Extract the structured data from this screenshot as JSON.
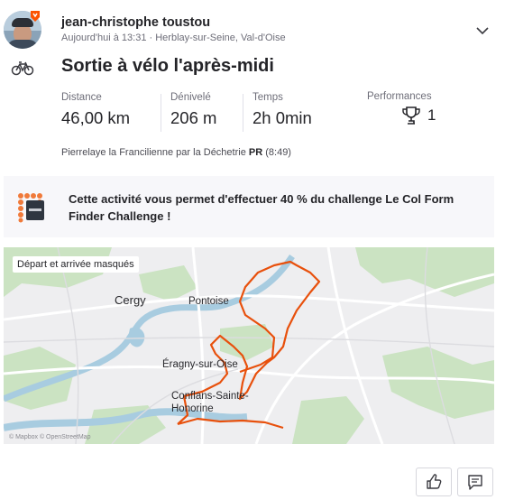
{
  "header": {
    "athlete_name": "jean-christophe toustou",
    "meta": "Aujourd'hui à 13:31 · Herblay-sur-Seine, Val-d'Oise"
  },
  "activity": {
    "title": "Sortie à vélo l'après-midi",
    "type_icon": "bike-icon"
  },
  "stats": [
    {
      "label": "Distance",
      "value": "46,00 km"
    },
    {
      "label": "Dénivelé",
      "value": "206 m"
    },
    {
      "label": "Temps",
      "value": "2h 0min"
    }
  ],
  "performances": {
    "label": "Performances",
    "count": "1"
  },
  "segment": {
    "name": "Pierrelaye la Francilienne par la Déchetrie",
    "pr": "PR",
    "time": "(8:49)"
  },
  "challenge": {
    "text": "Cette activité vous permet d'effectuer 40 % du challenge Le Col Form Finder Challenge !"
  },
  "map": {
    "privacy_chip": "Départ et arrivée masqués",
    "places": [
      "Cergy",
      "Pontoise",
      "Éragny-sur-Oise",
      "Conflans-Sainte-Honorine"
    ],
    "attribution": "© Mapbox © OpenStreetMap"
  },
  "colors": {
    "brand": "#fc5200",
    "route": "#e8500c",
    "water": "#a8cce0",
    "park": "#cbe3c2"
  }
}
